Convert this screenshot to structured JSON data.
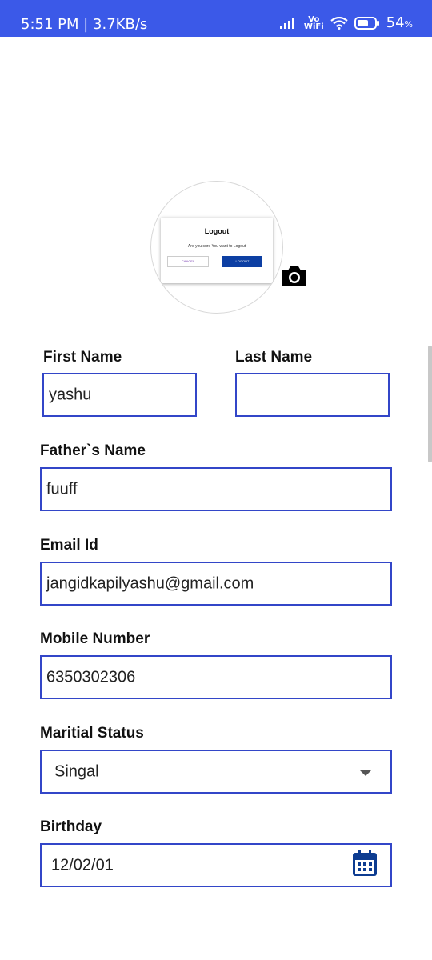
{
  "status_bar": {
    "time_speed": "5:51 PM | 3.7KB/s",
    "vo": "Vo",
    "wifi": "WiFi",
    "battery": "54",
    "battery_unit": "%"
  },
  "avatar_preview": {
    "dialog_title": "Logout",
    "dialog_message": "Are you sure You want to Logout",
    "cancel_label": "CANCEL",
    "logout_label": "LOGOUT"
  },
  "form": {
    "first_name": {
      "label": "First Name",
      "value": "yashu"
    },
    "last_name": {
      "label": "Last Name",
      "value": ""
    },
    "father_name": {
      "label": "Father`s Name",
      "value": "fuuff"
    },
    "email": {
      "label": "Email Id",
      "value": "jangidkapilyashu@gmail.com"
    },
    "mobile": {
      "label": "Mobile Number",
      "value": "6350302306"
    },
    "marital": {
      "label": "Maritial Status",
      "value": "Singal"
    },
    "birthday": {
      "label": "Birthday",
      "value": "12/02/01"
    }
  },
  "icons": {
    "camera": "camera-icon",
    "calendar": "calendar-icon",
    "dropdown": "dropdown-arrow-icon"
  },
  "colors": {
    "status_bar": "#3b59e8",
    "field_border": "#3346c8",
    "calendar": "#0d3c91"
  }
}
